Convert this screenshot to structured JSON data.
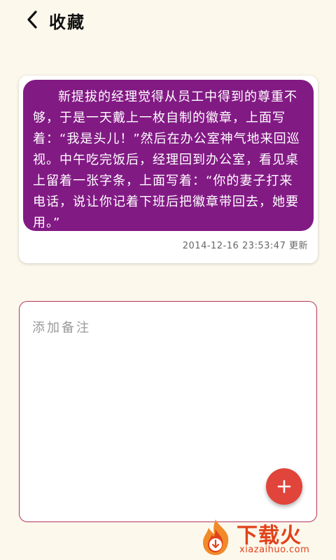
{
  "header": {
    "title": "收藏",
    "back_icon": "chevron-left-icon"
  },
  "favorite": {
    "quote_text": "新提拔的经理觉得从员工中得到的尊重不够，于是一天戴上一枚自制的徽章，上面写着：“我是头儿！”然后在办公室神气地来回巡视。中午吃完饭后，经理回到办公室，看见桌上留着一张字条，上面写着：“你的妻子打来电话，说让你记着下班后把徽章带回去，她要用。”",
    "timestamp": "2014-12-16 23:53:47",
    "status": "更新",
    "background_color": "#821a84"
  },
  "note": {
    "placeholder": "添加备注",
    "value": "",
    "border_color": "#b3345f"
  },
  "fab": {
    "icon": "plus-icon",
    "color": "#e0443b"
  },
  "watermark": {
    "brand": "下载火",
    "domain": "xiazaihuo.com",
    "color": "#e2421a"
  }
}
